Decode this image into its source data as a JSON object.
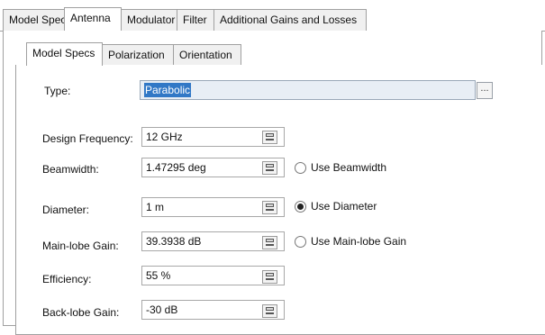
{
  "outer_tabs": [
    {
      "label": "Model Specs",
      "active": false
    },
    {
      "label": "Antenna",
      "active": true
    },
    {
      "label": "Modulator",
      "active": false
    },
    {
      "label": "Filter",
      "active": false
    },
    {
      "label": "Additional Gains and Losses",
      "active": false
    }
  ],
  "inner_tabs": [
    {
      "label": "Model Specs",
      "active": true
    },
    {
      "label": "Polarization",
      "active": false
    },
    {
      "label": "Orientation",
      "active": false
    }
  ],
  "type": {
    "label": "Type:",
    "value": "Parabolic",
    "browse_label": "..."
  },
  "design_frequency": {
    "label": "Design Frequency:",
    "value": "12 GHz"
  },
  "beamwidth": {
    "label": "Beamwidth:",
    "value": "1.47295 deg",
    "radio_label": "Use Beamwidth",
    "radio_checked": false
  },
  "diameter": {
    "label": "Diameter:",
    "value": "1 m",
    "radio_label": "Use Diameter",
    "radio_checked": true
  },
  "main_lobe_gain": {
    "label": "Main-lobe Gain:",
    "value": "39.3938 dB",
    "radio_label": "Use Main-lobe Gain",
    "radio_checked": false
  },
  "efficiency": {
    "label": "Efficiency:",
    "value": "55 %"
  },
  "back_lobe_gain": {
    "label": "Back-lobe Gain:",
    "value": "-30 dB"
  },
  "icons": {
    "unit_button": "unit-selector-icon"
  }
}
